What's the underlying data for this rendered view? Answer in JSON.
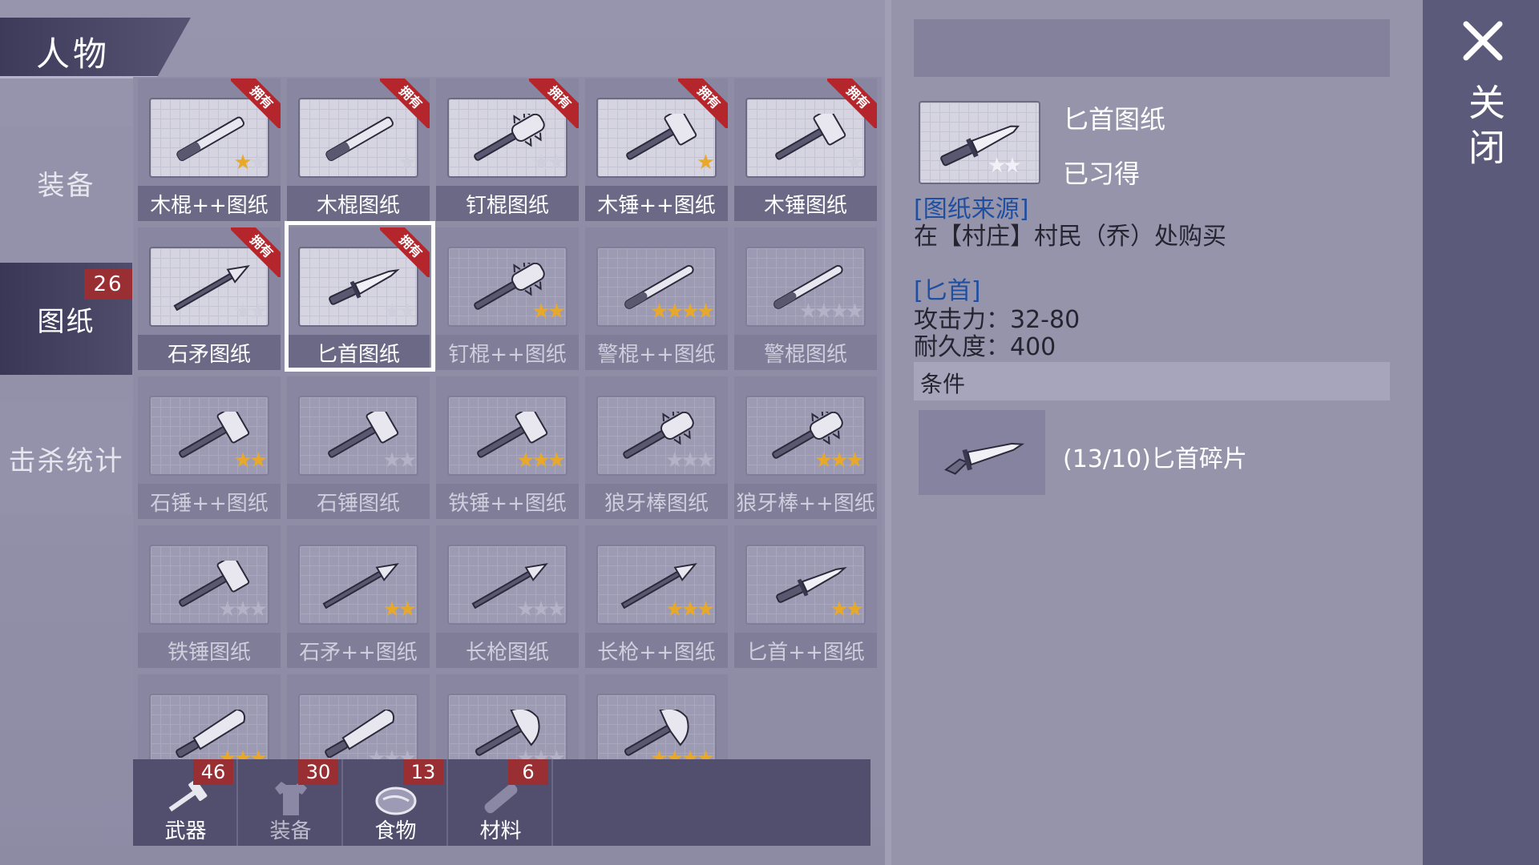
{
  "title": "人物",
  "sidebar": [
    {
      "label": "装备"
    },
    {
      "label": "图纸",
      "badge": "26"
    },
    {
      "label": "击杀统计"
    }
  ],
  "ribbon_text": "拥有",
  "blueprints": [
    {
      "label": "木棍++图纸",
      "stars": [
        1,
        0
      ],
      "owned": true,
      "icon": "club-plus-icon"
    },
    {
      "label": "木棍图纸",
      "stars": [
        0
      ],
      "owned": true,
      "icon": "club-icon"
    },
    {
      "label": "钉棍图纸",
      "stars": [
        0,
        0
      ],
      "owned": true,
      "icon": "spiked-club-icon"
    },
    {
      "label": "木锤++图纸",
      "stars": [
        1
      ],
      "owned": true,
      "icon": "wood-hammer-plus-icon"
    },
    {
      "label": "木锤图纸",
      "stars": [
        0
      ],
      "owned": true,
      "icon": "wood-hammer-icon"
    },
    {
      "label": "石矛图纸",
      "stars": [
        0,
        0
      ],
      "owned": true,
      "icon": "stone-spear-icon"
    },
    {
      "label": "匕首图纸",
      "stars": [
        0,
        0
      ],
      "owned": true,
      "icon": "dagger-icon"
    },
    {
      "label": "钉棍++图纸",
      "stars": [
        1,
        1
      ],
      "owned": false,
      "icon": "spiked-club-plus-icon"
    },
    {
      "label": "警棍++图纸",
      "stars": [
        1,
        1,
        1,
        1
      ],
      "owned": false,
      "icon": "baton-plus-icon"
    },
    {
      "label": "警棍图纸",
      "stars": [
        0,
        0,
        0,
        0
      ],
      "owned": false,
      "icon": "baton-icon"
    },
    {
      "label": "石锤++图纸",
      "stars": [
        1,
        1
      ],
      "owned": false,
      "icon": "stone-hammer-plus-icon"
    },
    {
      "label": "石锤图纸",
      "stars": [
        0,
        0
      ],
      "owned": false,
      "icon": "stone-hammer-icon"
    },
    {
      "label": "铁锤++图纸",
      "stars": [
        1,
        1,
        1
      ],
      "owned": false,
      "icon": "iron-hammer-plus-icon"
    },
    {
      "label": "狼牙棒图纸",
      "stars": [
        0,
        0,
        0
      ],
      "owned": false,
      "icon": "mace-icon"
    },
    {
      "label": "狼牙棒++图纸",
      "stars": [
        1,
        1,
        1
      ],
      "owned": false,
      "icon": "mace-plus-icon"
    },
    {
      "label": "铁锤图纸",
      "stars": [
        0,
        0,
        0
      ],
      "owned": false,
      "icon": "iron-hammer-icon"
    },
    {
      "label": "石矛++图纸",
      "stars": [
        1,
        1
      ],
      "owned": false,
      "icon": "stone-spear-plus-icon"
    },
    {
      "label": "长枪图纸",
      "stars": [
        0,
        0,
        0
      ],
      "owned": false,
      "icon": "long-spear-icon"
    },
    {
      "label": "长枪++图纸",
      "stars": [
        1,
        1,
        1
      ],
      "owned": false,
      "icon": "long-spear-plus-icon"
    },
    {
      "label": "匕首++图纸",
      "stars": [
        1,
        1
      ],
      "owned": false,
      "icon": "dagger-plus-icon"
    },
    {
      "label": "",
      "stars": [
        1,
        1,
        1
      ],
      "owned": false,
      "icon": "machete-plus-icon"
    },
    {
      "label": "",
      "stars": [
        0,
        0,
        0
      ],
      "owned": false,
      "icon": "machete-icon"
    },
    {
      "label": "",
      "stars": [
        0,
        0,
        0
      ],
      "owned": false,
      "icon": "axe-icon"
    },
    {
      "label": "",
      "stars": [
        1,
        1,
        1,
        1
      ],
      "owned": false,
      "icon": "axe-plus-icon"
    }
  ],
  "bottom_tabs": [
    {
      "label": "武器",
      "count": "46",
      "icon": "weapon-icon",
      "active": true
    },
    {
      "label": "装备",
      "count": "30",
      "icon": "shirt-icon",
      "active": false
    },
    {
      "label": "食物",
      "count": "13",
      "icon": "food-icon",
      "active": true
    },
    {
      "label": "材料",
      "count": "6",
      "icon": "wood-icon",
      "active": true
    }
  ],
  "detail": {
    "name": "匕首图纸",
    "status": "已习得",
    "thumb_stars": [
      0,
      0
    ],
    "source_title": "[图纸来源]",
    "source_text": "在【村庄】村民（乔）处购买",
    "weapon_title": "[匕首]",
    "attack": "攻击力：32-80",
    "durability": "耐久度：400",
    "condition_label": "条件",
    "material": "(13/10)匕首碎片",
    "material_icon": "dagger-fragment-icon"
  },
  "close_label": "关闭",
  "colors": {
    "ribbon": "#b4262c",
    "badge": "#9a2f33",
    "star": "#e8a92b",
    "link": "#1f4fa0"
  }
}
